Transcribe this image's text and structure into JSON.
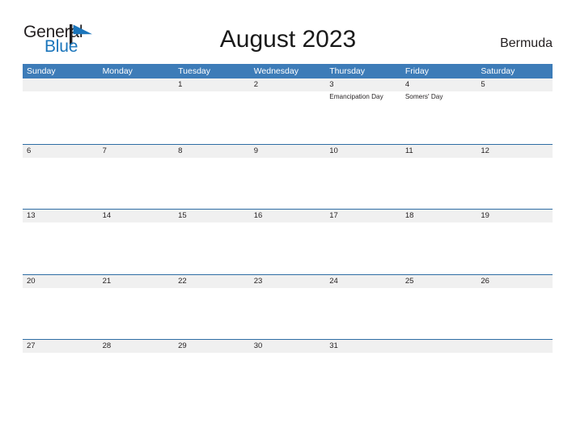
{
  "brand": {
    "name_part1": "General",
    "name_part2": "Blue",
    "mark_icon": "blue-flag-triangle-icon",
    "color_dark": "#231f20",
    "color_blue": "#1b75bb"
  },
  "header": {
    "title": "August 2023",
    "region": "Bermuda"
  },
  "theme": {
    "header_blue": "#3d7cb8",
    "rule_blue": "#2e6da4",
    "day_band_gray": "#f0f0f0",
    "text_dark": "#231f20",
    "page_background": "#ffffff"
  },
  "calendar": {
    "weekdays": [
      "Sunday",
      "Monday",
      "Tuesday",
      "Wednesday",
      "Thursday",
      "Friday",
      "Saturday"
    ],
    "weeks": [
      {
        "days": [
          {
            "num": "",
            "events": []
          },
          {
            "num": "",
            "events": []
          },
          {
            "num": "1",
            "events": []
          },
          {
            "num": "2",
            "events": []
          },
          {
            "num": "3",
            "events": [
              "Emancipation Day"
            ]
          },
          {
            "num": "4",
            "events": [
              "Somers' Day"
            ]
          },
          {
            "num": "5",
            "events": []
          }
        ]
      },
      {
        "days": [
          {
            "num": "6",
            "events": []
          },
          {
            "num": "7",
            "events": []
          },
          {
            "num": "8",
            "events": []
          },
          {
            "num": "9",
            "events": []
          },
          {
            "num": "10",
            "events": []
          },
          {
            "num": "11",
            "events": []
          },
          {
            "num": "12",
            "events": []
          }
        ]
      },
      {
        "days": [
          {
            "num": "13",
            "events": []
          },
          {
            "num": "14",
            "events": []
          },
          {
            "num": "15",
            "events": []
          },
          {
            "num": "16",
            "events": []
          },
          {
            "num": "17",
            "events": []
          },
          {
            "num": "18",
            "events": []
          },
          {
            "num": "19",
            "events": []
          }
        ]
      },
      {
        "days": [
          {
            "num": "20",
            "events": []
          },
          {
            "num": "21",
            "events": []
          },
          {
            "num": "22",
            "events": []
          },
          {
            "num": "23",
            "events": []
          },
          {
            "num": "24",
            "events": []
          },
          {
            "num": "25",
            "events": []
          },
          {
            "num": "26",
            "events": []
          }
        ]
      },
      {
        "days": [
          {
            "num": "27",
            "events": []
          },
          {
            "num": "28",
            "events": []
          },
          {
            "num": "29",
            "events": []
          },
          {
            "num": "30",
            "events": []
          },
          {
            "num": "31",
            "events": []
          },
          {
            "num": "",
            "events": []
          },
          {
            "num": "",
            "events": []
          }
        ]
      }
    ]
  }
}
